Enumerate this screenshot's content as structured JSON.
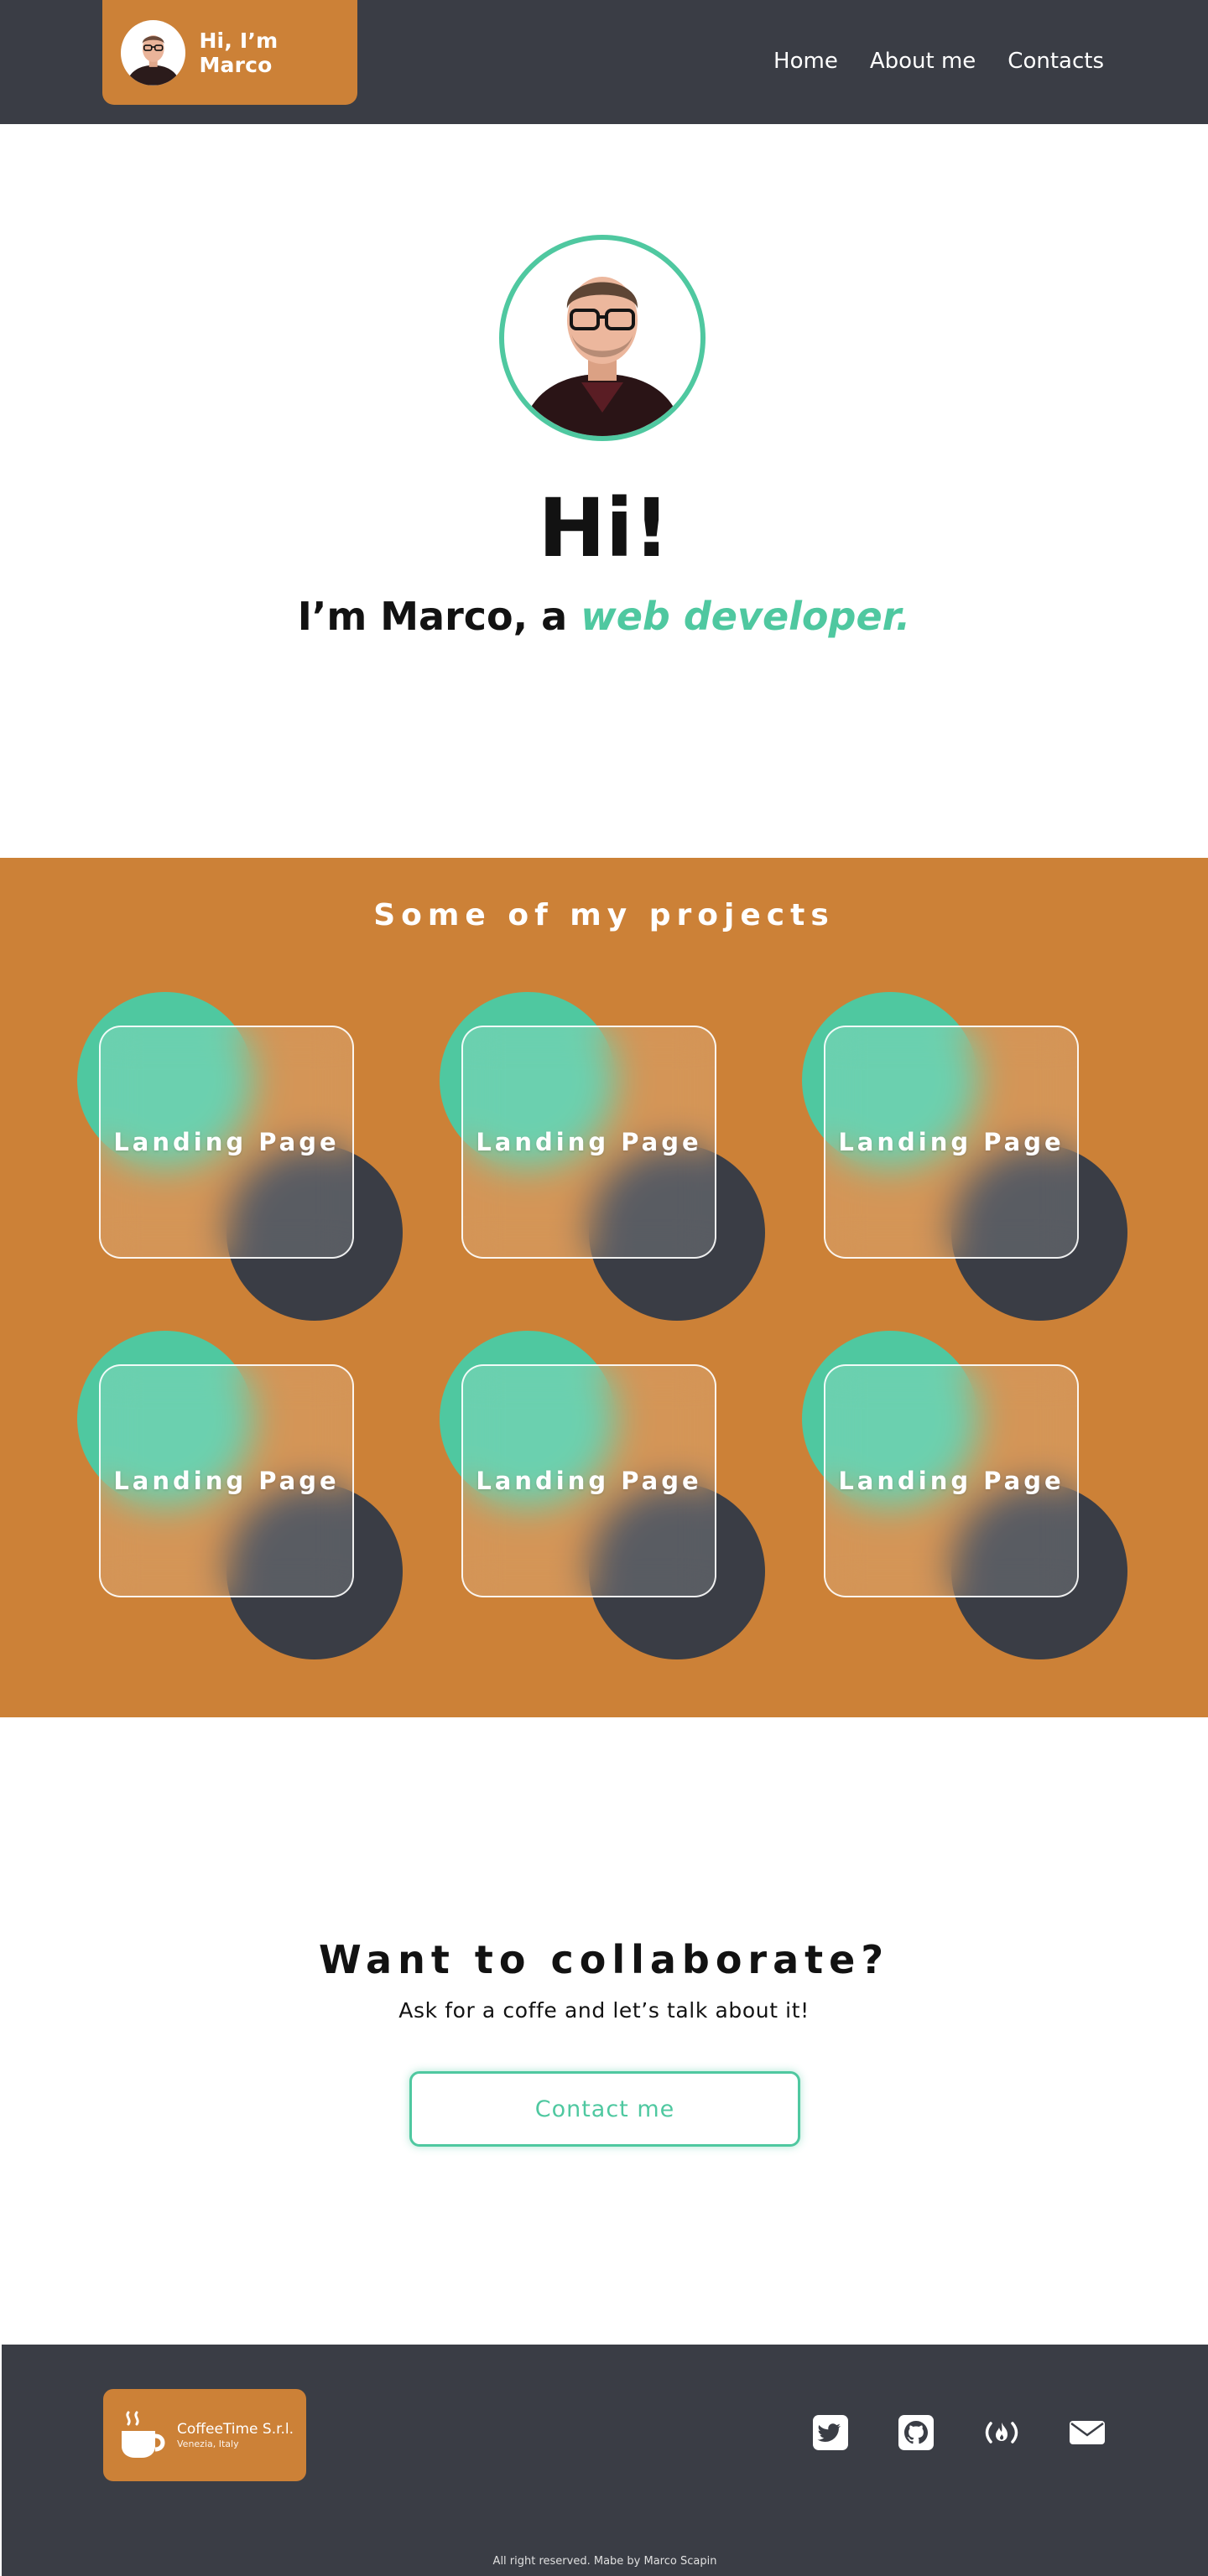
{
  "header": {
    "brand_name": "Hi, I’m Marco",
    "nav": [
      {
        "label": "Home"
      },
      {
        "label": "About me"
      },
      {
        "label": "Contacts"
      }
    ]
  },
  "hero": {
    "greeting": "Hi!",
    "subtitle_prefix": "I’m Marco, a ",
    "subtitle_accent": "web developer."
  },
  "projects": {
    "title": "Some of my projects",
    "cards": [
      {
        "label": "Landing Page"
      },
      {
        "label": "Landing Page"
      },
      {
        "label": "Landing Page"
      },
      {
        "label": "Landing Page"
      },
      {
        "label": "Landing Page"
      },
      {
        "label": "Landing Page"
      }
    ]
  },
  "collaborate": {
    "title": "Want to collaborate?",
    "subtitle": "Ask for a coffe and let’s talk about it!",
    "button_label": "Contact me"
  },
  "footer": {
    "company": "CoffeeTime S.r.l.",
    "location": "Venezia, Italy",
    "social_icons": [
      "twitter-icon",
      "github-icon",
      "freecodecamp-icon",
      "envelope-icon"
    ],
    "copyright": "All right reserved. Mabe by Marco Scapin"
  },
  "colors": {
    "header_bg": "#3a3d45",
    "accent_orange": "#cc8137",
    "accent_green": "#4fc8a0",
    "text_dark": "#121212"
  }
}
